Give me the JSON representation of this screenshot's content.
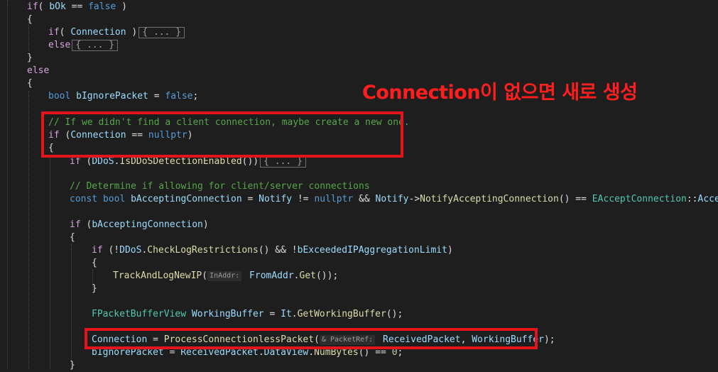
{
  "code": {
    "l1": {
      "kw": "if",
      "p1": "( ",
      "v1": "bOk",
      "op": " == ",
      "kw2": "false",
      "p2": " )"
    },
    "l2": {
      "t": "{"
    },
    "l3": {
      "kw": "if",
      "p1": "( ",
      "v1": "Connection",
      "p2": " )",
      "fold": "{ ... }"
    },
    "l4": {
      "kw": "else",
      "fold": "{ ... }"
    },
    "l5": {
      "t": "}"
    },
    "l6": {
      "kw": "else"
    },
    "l7": {
      "t": "{"
    },
    "l8": {
      "ty": "bool",
      "v": " bIgnorePacket",
      "op": " = ",
      "kw": "false",
      "end": ";"
    },
    "l9": {
      "cm": "// If we didn't find a client connection, maybe create a new one."
    },
    "l10": {
      "kw": "if",
      "p1": " (",
      "v1": "Connection",
      "op": " == ",
      "kw2": "nullptr",
      "p2": ")"
    },
    "l11": {
      "t": "{"
    },
    "l12": {
      "kw": "if",
      "p1": " (",
      "v1": "DDoS",
      "p2": ".",
      "fn": "IsDDoSDetectionEnabled",
      "p3": "())",
      "fold": "{ ... }"
    },
    "l13": {
      "cm": "// Determine if allowing for client/server connections"
    },
    "l14": {
      "kw": "const",
      "ty": " bool",
      "v1": " bAcceptingConnection",
      "op1": " = ",
      "v2": "Notify",
      "op2": " != ",
      "kw2": "nullptr",
      "op3": " && ",
      "v3": "Notify",
      "op4": "->",
      "fn": "NotifyAcceptingConnection",
      "op5": "() == ",
      "ty2": "EAcceptConnection",
      "op6": "::",
      "v4": "Accept",
      "end": ";"
    },
    "l15": {
      "kw": "if",
      "p1": " (",
      "v1": "bAcceptingConnection",
      "p2": ")"
    },
    "l16": {
      "t": "{"
    },
    "l17": {
      "kw": "if",
      "p1": " (!",
      "v1": "DDoS",
      "p2": ".",
      "fn": "CheckLogRestrictions",
      "p3": "() && !",
      "v2": "bExceededIPAggregationLimit",
      "p4": ")"
    },
    "l18": {
      "t": "{"
    },
    "l19": {
      "fn": "TrackAndLogNewIP",
      "p1": "(",
      "hint": "InAddr:",
      "v1": " FromAddr",
      "p2": ".",
      "fn2": "Get",
      "p3": "());"
    },
    "l20": {
      "t": "}"
    },
    "l21": {
      "ty": "FPacketBufferView",
      "v1": " WorkingBuffer",
      "op": " = ",
      "v2": "It",
      "p1": ".",
      "fn": "GetWorkingBuffer",
      "p2": "();"
    },
    "l22": {
      "v1": "Connection",
      "op": " = ",
      "fn": "ProcessConnectionlessPacket",
      "p1": "(",
      "hint": "& PacketRef:",
      "v2": " ReceivedPacket",
      "p2": ", ",
      "v3": "WorkingBuffer",
      "p3": ");"
    },
    "l23": {
      "v1": "bIgnorePacket",
      "op": " = ",
      "v2": "ReceivedPacket",
      "p1": ".",
      "v3": "DataView",
      "p2": ".",
      "fn": "NumBytes",
      "p3": "() == ",
      "num": "0",
      "end": ";"
    },
    "l24": {
      "t": "}"
    }
  },
  "annotation": {
    "text": "Connection이 없으면 새로 생성"
  },
  "colors": {
    "highlight_box": "#e3141b",
    "annotation": "#ff1e1e",
    "background": "#1e1e1e"
  }
}
